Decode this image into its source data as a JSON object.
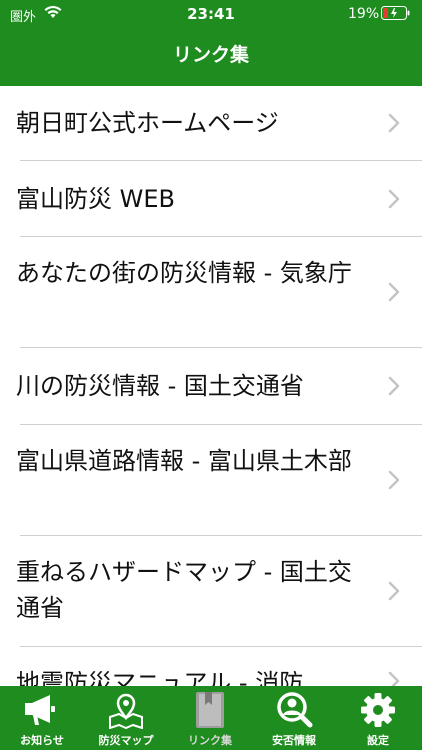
{
  "status_bar": {
    "carrier": "圏外",
    "time": "23:41",
    "battery": "19%"
  },
  "nav": {
    "title": "リンク集"
  },
  "links": [
    {
      "label": "朝日町公式ホームページ"
    },
    {
      "label": "富山防災 WEB"
    },
    {
      "label": "あなたの街の防災情報 - 気象庁"
    },
    {
      "label": "川の防災情報 - 国土交通省"
    },
    {
      "label": "富山県道路情報 - 富山県土木部"
    },
    {
      "label": "重ねるハザードマップ - 国土交通省"
    },
    {
      "label": "地震防災マニュアル - 消防"
    }
  ],
  "tabs": [
    {
      "label": "お知らせ",
      "icon": "megaphone-icon"
    },
    {
      "label": "防災マップ",
      "icon": "map-pin-icon"
    },
    {
      "label": "リンク集",
      "icon": "bookmark-book-icon",
      "selected": true
    },
    {
      "label": "安否情報",
      "icon": "search-person-icon"
    },
    {
      "label": "設定",
      "icon": "gear-icon"
    }
  ],
  "colors": {
    "brand_green": "#1e8c1e",
    "separator": "#d0d0d0",
    "chevron": "#c4c4c7"
  }
}
